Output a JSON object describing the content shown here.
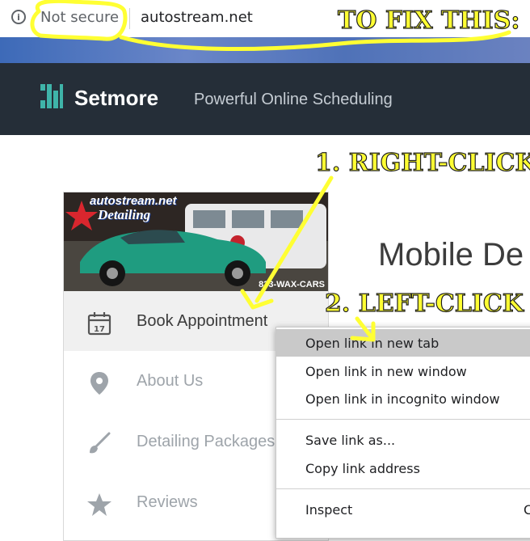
{
  "browser": {
    "security_label": "Not secure",
    "url": "autostream.net"
  },
  "header": {
    "brand": "Setmore",
    "tagline": "Powerful Online Scheduling"
  },
  "card": {
    "image_title": "autostream.net",
    "image_subtitle": "Detailing",
    "image_phone": "833-WAX-CARS",
    "menu": [
      {
        "label": "Book Appointment",
        "icon": "calendar-icon",
        "date": "17"
      },
      {
        "label": "About Us",
        "icon": "location-pin-icon"
      },
      {
        "label": "Detailing Packages",
        "icon": "brush-icon"
      },
      {
        "label": "Reviews",
        "icon": "star-icon"
      }
    ]
  },
  "main": {
    "title": "Mobile De"
  },
  "context_menu": {
    "items": [
      {
        "label": "Open link in new tab"
      },
      {
        "label": "Open link in new window"
      },
      {
        "label": "Open link in incognito window"
      },
      {
        "label": "Save link as..."
      },
      {
        "label": "Copy link address"
      },
      {
        "label": "Inspect",
        "shortcut": "C"
      }
    ]
  },
  "annotations": {
    "heading": "TO FIX THIS:",
    "step1": "1. RIGHT-CLICK",
    "step2": "2. LEFT-CLICK"
  },
  "colors": {
    "header_bg": "#252e38",
    "logo_teal": "#3fb4a9",
    "annotation_yellow": "#ffff33",
    "menu_highlight": "#c9c9c9"
  }
}
